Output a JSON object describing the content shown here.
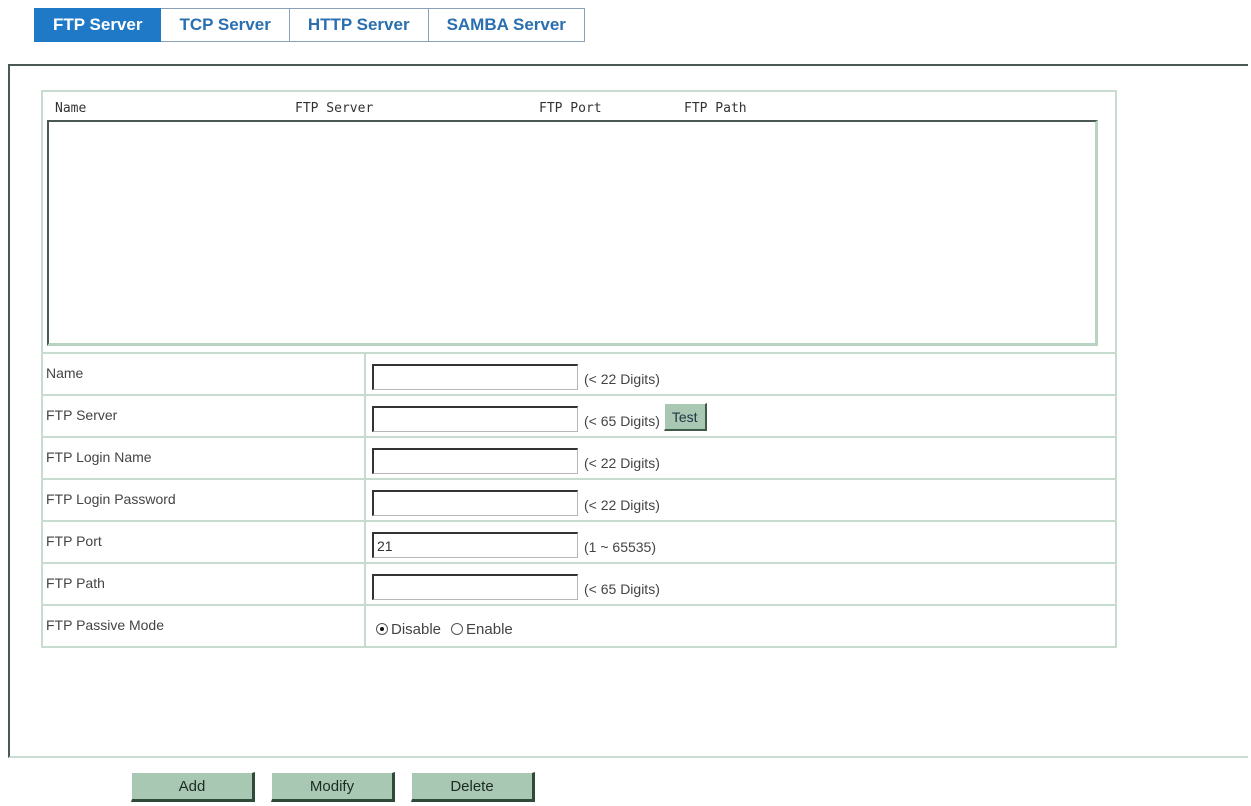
{
  "tabs": [
    {
      "label": "FTP Server",
      "active": true
    },
    {
      "label": "TCP Server",
      "active": false
    },
    {
      "label": "HTTP Server",
      "active": false
    },
    {
      "label": "SAMBA Server",
      "active": false
    }
  ],
  "list": {
    "columns": [
      "Name",
      "FTP Server",
      "FTP Port",
      "FTP Path"
    ],
    "rows": []
  },
  "form": {
    "name": {
      "label": "Name",
      "value": "",
      "hint": "(< 22 Digits)"
    },
    "server": {
      "label": "FTP Server",
      "value": "",
      "hint": "(< 65 Digits)",
      "test_label": "Test"
    },
    "login_name": {
      "label": "FTP Login Name",
      "value": "",
      "hint": "(< 22 Digits)"
    },
    "login_password": {
      "label": "FTP Login Password",
      "value": "",
      "hint": "(< 22 Digits)"
    },
    "port": {
      "label": "FTP Port",
      "value": "21",
      "hint": "(1 ~ 65535)"
    },
    "path": {
      "label": "FTP Path",
      "value": "",
      "hint": "(< 65 Digits)"
    },
    "passive_mode": {
      "label": "FTP Passive Mode",
      "options": [
        {
          "label": "Disable",
          "checked": true
        },
        {
          "label": "Enable",
          "checked": false
        }
      ]
    }
  },
  "actions": {
    "add_label": "Add",
    "modify_label": "Modify",
    "delete_label": "Delete"
  },
  "colors": {
    "active_tab": "#1f79c6",
    "tab_text": "#2a6fb0",
    "button_face": "#a9c8b3",
    "grid_line": "#c7dccf"
  }
}
